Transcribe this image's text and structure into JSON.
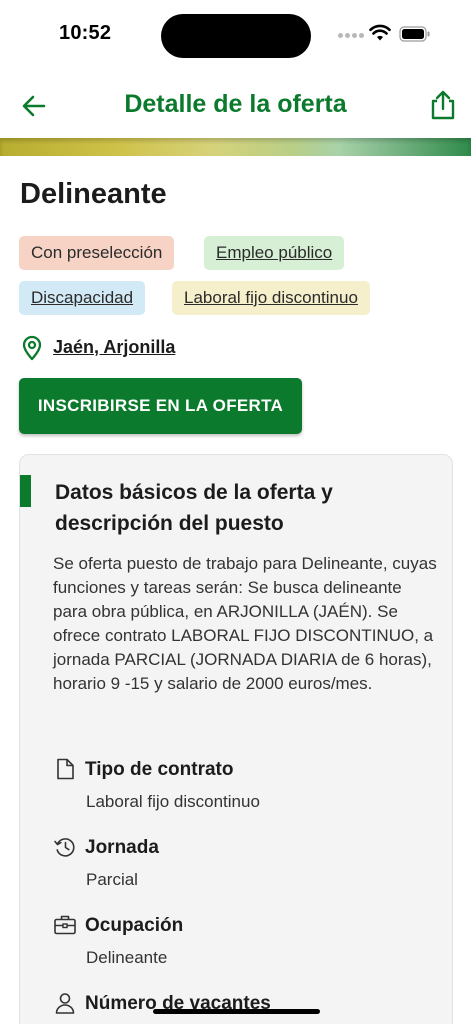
{
  "status_bar": {
    "time": "10:52"
  },
  "header": {
    "title": "Detalle de la oferta",
    "back_icon": "arrow-left-icon",
    "share_icon": "share-icon",
    "accent_color": "#0b7a2c"
  },
  "job": {
    "title": "Delineante",
    "tags": [
      {
        "label": "Con preselección",
        "color": "#f6d3c4"
      },
      {
        "label": "Empleo público",
        "color": "#d7f0d5"
      },
      {
        "label": "Discapacidad",
        "color": "#d2eaf6"
      },
      {
        "label": "Laboral fijo discontinuo",
        "color": "#f6efcc"
      }
    ],
    "location": "Jaén, Arjonilla",
    "apply_label": "INSCRIBIRSE EN LA OFERTA"
  },
  "details": {
    "heading": "Datos básicos de la oferta y descripción del puesto",
    "description": "Se oferta puesto de trabajo para Delineante, cuyas funciones y tareas serán: Se busca delineante para obra pública, en ARJONILLA (JAÉN). Se ofrece contrato LABORAL FIJO DISCONTINUO, a jornada PARCIAL (JORNADA DIARIA de 6 horas), horario 9 -15 y salario de 2000 euros/mes.",
    "items": [
      {
        "icon": "document-icon",
        "label": "Tipo de contrato",
        "value": "Laboral fijo discontinuo"
      },
      {
        "icon": "history-icon",
        "label": "Jornada",
        "value": "Parcial"
      },
      {
        "icon": "briefcase-icon",
        "label": "Ocupación",
        "value": "Delineante"
      },
      {
        "icon": "person-icon",
        "label": "Número de vacantes",
        "value": ""
      }
    ]
  }
}
